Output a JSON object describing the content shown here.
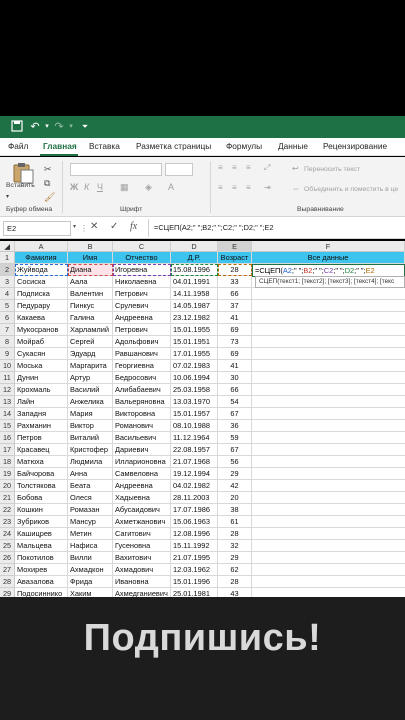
{
  "titlebar": {
    "icons": [
      "save-icon",
      "undo-icon",
      "redo-icon",
      "customize-icon"
    ]
  },
  "menu": {
    "items": [
      "Файл",
      "Главная",
      "Вставка",
      "Разметка страницы",
      "Формулы",
      "Данные",
      "Рецензирование"
    ],
    "active": "Главная"
  },
  "ribbon": {
    "paste_label": "Вставить",
    "clipboard_group": "Буфер обмена",
    "font_group": "Шрифт",
    "wrap_text": "Переносить текст",
    "merge_center": "Объединить и поместить в це",
    "alignment_group": "Выравнивание"
  },
  "formula_bar": {
    "name_box": "E2",
    "cancel": "✕",
    "enter": "✓",
    "fx": "fx",
    "formula": "=СЦЕП(A2;\" \";B2;\" \";C2;\" \";D2;\" \";E2"
  },
  "columns": [
    "A",
    "B",
    "C",
    "D",
    "E",
    "F"
  ],
  "selected_column": "E",
  "headers": [
    "Фамилия",
    "Имя",
    "Отчество",
    "Д.Р.",
    "Возраст",
    "Все данные"
  ],
  "active_cell_text": "28",
  "editing_formula": {
    "prefix": "=СЦЕП(",
    "refs": [
      "A2",
      "B2",
      "C2",
      "D2",
      "E2"
    ],
    "sep": "\" \""
  },
  "tooltip": "СЦЕП(текст1; [текст2]; [текст3]; [текст4]; [текс",
  "rows": [
    {
      "n": "2",
      "last": "Жуйвода",
      "first": "Диана",
      "middle": "Игоревна",
      "dob": "15.08.1996",
      "age": "28"
    },
    {
      "n": "3",
      "last": "Сосиска",
      "first": "Аала",
      "middle": "Николаевна",
      "dob": "04.01.1991",
      "age": "33"
    },
    {
      "n": "4",
      "last": "Подписка",
      "first": "Валентин",
      "middle": "Петрович",
      "dob": "14.11.1958",
      "age": "66"
    },
    {
      "n": "5",
      "last": "Педурару",
      "first": "Пинкус",
      "middle": "Срулевич",
      "dob": "14.05.1987",
      "age": "37"
    },
    {
      "n": "6",
      "last": "Какаева",
      "first": "Галина",
      "middle": "Андреевна",
      "dob": "23.12.1982",
      "age": "41"
    },
    {
      "n": "7",
      "last": "Мукосранов",
      "first": "Харламлий",
      "middle": "Петрович",
      "dob": "15.01.1955",
      "age": "69"
    },
    {
      "n": "8",
      "last": "Мойраб",
      "first": "Сергей",
      "middle": "Адольфович",
      "dob": "15.01.1951",
      "age": "73"
    },
    {
      "n": "9",
      "last": "Сукасян",
      "first": "Эдуард",
      "middle": "Равшанович",
      "dob": "17.01.1955",
      "age": "69"
    },
    {
      "n": "10",
      "last": "Моська",
      "first": "Маргарита",
      "middle": "Георгиевна",
      "dob": "07.02.1983",
      "age": "41"
    },
    {
      "n": "11",
      "last": "Дунин",
      "first": "Артур",
      "middle": "Бедросович",
      "dob": "10.06.1994",
      "age": "30"
    },
    {
      "n": "12",
      "last": "Крохмаль",
      "first": "Василий",
      "middle": "Алибабаевич",
      "dob": "25.03.1958",
      "age": "66"
    },
    {
      "n": "13",
      "last": "Лайн",
      "first": "Анжелика",
      "middle": "Вальеряновна",
      "dob": "13.03.1970",
      "age": "54"
    },
    {
      "n": "14",
      "last": "Западня",
      "first": "Мария",
      "middle": "Викторовна",
      "dob": "15.01.1957",
      "age": "67"
    },
    {
      "n": "15",
      "last": "Рахманин",
      "first": "Виктор",
      "middle": "Романович",
      "dob": "08.10.1988",
      "age": "36"
    },
    {
      "n": "16",
      "last": "Петров",
      "first": "Виталий",
      "middle": "Васильевич",
      "dob": "11.12.1964",
      "age": "59"
    },
    {
      "n": "17",
      "last": "Красавец",
      "first": "Кристофер",
      "middle": "Дариевич",
      "dob": "22.08.1957",
      "age": "67"
    },
    {
      "n": "18",
      "last": "Матюха",
      "first": "Людмила",
      "middle": "Илларионовна",
      "dob": "21.07.1968",
      "age": "56"
    },
    {
      "n": "19",
      "last": "Байчорова",
      "first": "Анна",
      "middle": "Самвеловна",
      "dob": "19.12.1994",
      "age": "29"
    },
    {
      "n": "20",
      "last": "Толстякова",
      "first": "Беата",
      "middle": "Андреевна",
      "dob": "04.02.1982",
      "age": "42"
    },
    {
      "n": "21",
      "last": "Бобова",
      "first": "Олеся",
      "middle": "Хадыевна",
      "dob": "28.11.2003",
      "age": "20"
    },
    {
      "n": "22",
      "last": "Кошкин",
      "first": "Ромазан",
      "middle": "Абусаидович",
      "dob": "17.07.1986",
      "age": "38"
    },
    {
      "n": "23",
      "last": "Зубриков",
      "first": "Мансур",
      "middle": "Ахметжанович",
      "dob": "15.06.1963",
      "age": "61"
    },
    {
      "n": "24",
      "last": "Кашицрев",
      "first": "Метин",
      "middle": "Сагитович",
      "dob": "12.08.1996",
      "age": "28"
    },
    {
      "n": "25",
      "last": "Мальцева",
      "first": "Нафиса",
      "middle": "Гусеновна",
      "dob": "15.11.1992",
      "age": "32"
    },
    {
      "n": "26",
      "last": "Покотилов",
      "first": "Вилли",
      "middle": "Вахитович",
      "dob": "21.07.1995",
      "age": "29"
    },
    {
      "n": "27",
      "last": "Мохирев",
      "first": "Ахмадкон",
      "middle": "Ахмадович",
      "dob": "12.03.1962",
      "age": "62"
    },
    {
      "n": "28",
      "last": "Авазалова",
      "first": "Фрида",
      "middle": "Ивановна",
      "dob": "15.01.1996",
      "age": "28"
    },
    {
      "n": "29",
      "last": "Подосиннико",
      "first": "Хаким",
      "middle": "Ахмедганиевич",
      "dob": "25.01.1981",
      "age": "43"
    }
  ],
  "banner": {
    "text": "Подпишись!"
  },
  "colors": {
    "header_fill": "#3cc3ee",
    "excel_green": "#1e7145",
    "pink_cell": "#fde2e8",
    "banner_bg": "#1d1d1d"
  }
}
